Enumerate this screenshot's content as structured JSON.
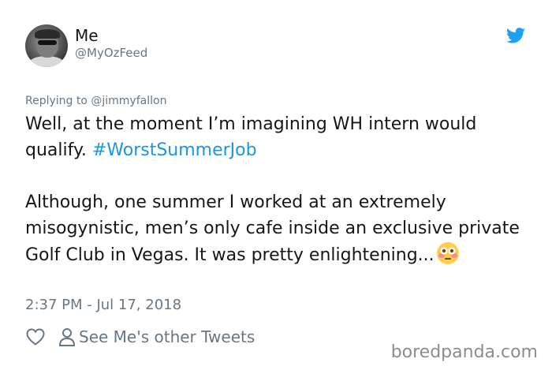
{
  "user": {
    "name": "Me",
    "handle": "@MyOzFeed",
    "avatar_icon": "user-avatar-photo"
  },
  "brand": {
    "icon": "twitter-bird-icon",
    "color": "#1da1f2"
  },
  "tweet": {
    "replying_to": "Replying to @jimmyfallon",
    "line1_text": "Well, at the moment I’m imagining WH intern would qualify. ",
    "hashtag": "#WorstSummerJob",
    "paragraph2": "Although, one summer I worked at an extremely misogynistic, men’s only cafe inside an exclusive private Golf Club in Vegas. It was pretty enlightening...",
    "emoji_icon": "flushed-face-icon",
    "timestamp": "2:37 PM - Jul 17, 2018"
  },
  "actions": {
    "like_icon": "heart-icon",
    "profile_icon": "person-icon",
    "other_tweets_label": "See Me's other Tweets"
  },
  "watermark": "boredpanda.com",
  "colors": {
    "text": "#14171a",
    "secondary": "#657786",
    "link": "#1b95e0"
  }
}
